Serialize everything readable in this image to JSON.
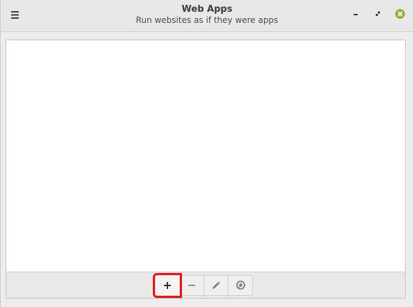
{
  "window": {
    "title": "Web Apps",
    "subtitle": "Run websites as if they were apps"
  },
  "header": {
    "menu_icon": "hamburger-menu-icon",
    "controls": [
      "minimize-icon",
      "restore-icon",
      "close-icon"
    ]
  },
  "toolbar": {
    "buttons": [
      {
        "name": "add-button",
        "icon": "plus-icon",
        "highlighted": true
      },
      {
        "name": "remove-button",
        "icon": "minus-icon",
        "highlighted": false
      },
      {
        "name": "edit-button",
        "icon": "pencil-icon",
        "highlighted": false
      },
      {
        "name": "launch-button",
        "icon": "rocket-icon",
        "highlighted": false
      }
    ]
  },
  "colors": {
    "highlight": "#e2151b",
    "close_button": "#8fb04a"
  }
}
